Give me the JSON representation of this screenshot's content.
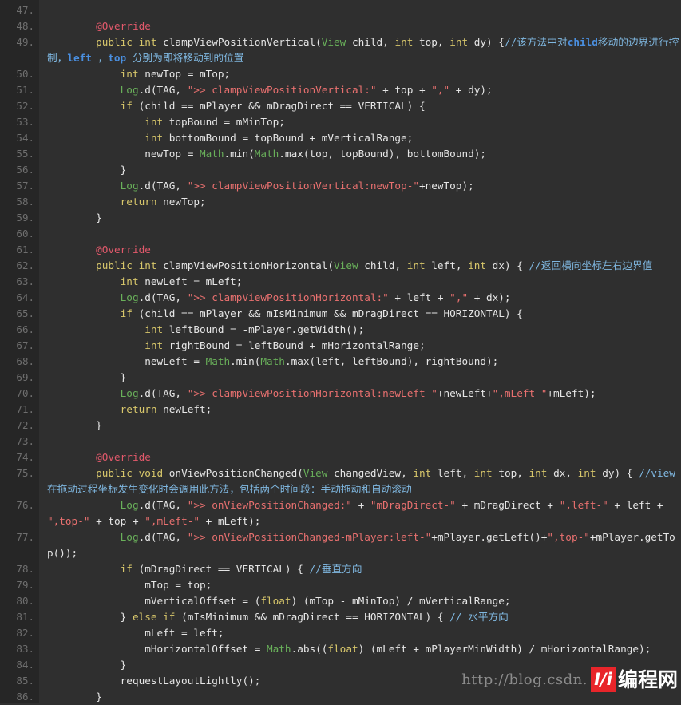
{
  "editor": {
    "language": "java",
    "theme": "dark",
    "background_color": "#2f2f2f",
    "gutter_color": "#262626",
    "first_line_number": 47,
    "last_line_number": 86
  },
  "colors": {
    "keyword": "#d8c76b",
    "annotation": "#e2596b",
    "string": "#e8706f",
    "class_name": "#69b05a",
    "comment": "#7fb7e0",
    "comment_bold": "#4a8fe0",
    "plain_text": "#e6e6e6",
    "line_number": "#6e6e6e",
    "watermark_red": "#e8252a"
  },
  "watermark": {
    "url": "http://blog.csdn.",
    "logo_mark": "I/i",
    "logo_text": "编程网"
  },
  "lines": [
    {
      "num": "47.",
      "wrapped": 0,
      "tokens": []
    },
    {
      "num": "48.",
      "wrapped": 0,
      "tokens": [
        {
          "c": "t-pl",
          "t": "        "
        },
        {
          "c": "t-ann",
          "t": "@Override"
        }
      ]
    },
    {
      "num": "49.",
      "wrapped": 1,
      "tokens": [
        {
          "c": "t-pl",
          "t": "        "
        },
        {
          "c": "t-kw",
          "t": "public"
        },
        {
          "c": "t-pl",
          "t": " "
        },
        {
          "c": "t-kw",
          "t": "int"
        },
        {
          "c": "t-pl",
          "t": " clampViewPositionVertical("
        },
        {
          "c": "t-cls",
          "t": "View"
        },
        {
          "c": "t-pl",
          "t": " child, "
        },
        {
          "c": "t-kw",
          "t": "int"
        },
        {
          "c": "t-pl",
          "t": " top, "
        },
        {
          "c": "t-kw",
          "t": "int"
        },
        {
          "c": "t-pl",
          "t": " dy) {"
        },
        {
          "c": "t-cmt",
          "t": "//该方法中对"
        },
        {
          "c": "t-cmt-b",
          "t": "child"
        },
        {
          "c": "t-cmt",
          "t": "移动的边界进行控制，"
        },
        {
          "c": "t-cmt-b",
          "t": "left"
        },
        {
          "c": "t-cmt",
          "t": " ，"
        },
        {
          "c": "t-cmt-b",
          "t": "top"
        },
        {
          "c": "t-cmt",
          "t": " 分别为即将移动到的位置"
        }
      ]
    },
    {
      "num": "50.",
      "wrapped": 0,
      "tokens": [
        {
          "c": "t-pl",
          "t": "            "
        },
        {
          "c": "t-kw",
          "t": "int"
        },
        {
          "c": "t-pl",
          "t": " newTop = mTop;"
        }
      ]
    },
    {
      "num": "51.",
      "wrapped": 0,
      "tokens": [
        {
          "c": "t-pl",
          "t": "            "
        },
        {
          "c": "t-cls",
          "t": "Log"
        },
        {
          "c": "t-pl",
          "t": ".d(TAG, "
        },
        {
          "c": "t-str",
          "t": "\">> clampViewPositionVertical:\""
        },
        {
          "c": "t-pl",
          "t": " + top + "
        },
        {
          "c": "t-str",
          "t": "\",\""
        },
        {
          "c": "t-pl",
          "t": " + dy);"
        }
      ]
    },
    {
      "num": "52.",
      "wrapped": 0,
      "tokens": [
        {
          "c": "t-pl",
          "t": "            "
        },
        {
          "c": "t-kw",
          "t": "if"
        },
        {
          "c": "t-pl",
          "t": " (child == mPlayer && mDragDirect == VERTICAL) {"
        }
      ]
    },
    {
      "num": "53.",
      "wrapped": 0,
      "tokens": [
        {
          "c": "t-pl",
          "t": "                "
        },
        {
          "c": "t-kw",
          "t": "int"
        },
        {
          "c": "t-pl",
          "t": " topBound = mMinTop;"
        }
      ]
    },
    {
      "num": "54.",
      "wrapped": 0,
      "tokens": [
        {
          "c": "t-pl",
          "t": "                "
        },
        {
          "c": "t-kw",
          "t": "int"
        },
        {
          "c": "t-pl",
          "t": " bottomBound = topBound + mVerticalRange;"
        }
      ]
    },
    {
      "num": "55.",
      "wrapped": 0,
      "tokens": [
        {
          "c": "t-pl",
          "t": "                newTop = "
        },
        {
          "c": "t-cls",
          "t": "Math"
        },
        {
          "c": "t-pl",
          "t": ".min("
        },
        {
          "c": "t-cls",
          "t": "Math"
        },
        {
          "c": "t-pl",
          "t": ".max(top, topBound), bottomBound);"
        }
      ]
    },
    {
      "num": "56.",
      "wrapped": 0,
      "tokens": [
        {
          "c": "t-pl",
          "t": "            }"
        }
      ]
    },
    {
      "num": "57.",
      "wrapped": 0,
      "tokens": [
        {
          "c": "t-pl",
          "t": "            "
        },
        {
          "c": "t-cls",
          "t": "Log"
        },
        {
          "c": "t-pl",
          "t": ".d(TAG, "
        },
        {
          "c": "t-str",
          "t": "\">> clampViewPositionVertical:newTop-\""
        },
        {
          "c": "t-pl",
          "t": "+newTop);"
        }
      ]
    },
    {
      "num": "58.",
      "wrapped": 0,
      "tokens": [
        {
          "c": "t-pl",
          "t": "            "
        },
        {
          "c": "t-kw",
          "t": "return"
        },
        {
          "c": "t-pl",
          "t": " newTop;"
        }
      ]
    },
    {
      "num": "59.",
      "wrapped": 0,
      "tokens": [
        {
          "c": "t-pl",
          "t": "        }"
        }
      ]
    },
    {
      "num": "60.",
      "wrapped": 0,
      "tokens": []
    },
    {
      "num": "61.",
      "wrapped": 0,
      "tokens": [
        {
          "c": "t-pl",
          "t": "        "
        },
        {
          "c": "t-ann",
          "t": "@Override"
        }
      ]
    },
    {
      "num": "62.",
      "wrapped": 0,
      "tokens": [
        {
          "c": "t-pl",
          "t": "        "
        },
        {
          "c": "t-kw",
          "t": "public"
        },
        {
          "c": "t-pl",
          "t": " "
        },
        {
          "c": "t-kw",
          "t": "int"
        },
        {
          "c": "t-pl",
          "t": " clampViewPositionHorizontal("
        },
        {
          "c": "t-cls",
          "t": "View"
        },
        {
          "c": "t-pl",
          "t": " child, "
        },
        {
          "c": "t-kw",
          "t": "int"
        },
        {
          "c": "t-pl",
          "t": " left, "
        },
        {
          "c": "t-kw",
          "t": "int"
        },
        {
          "c": "t-pl",
          "t": " dx) { "
        },
        {
          "c": "t-cmt",
          "t": "//返回横向坐标左右边界值"
        }
      ]
    },
    {
      "num": "63.",
      "wrapped": 0,
      "tokens": [
        {
          "c": "t-pl",
          "t": "            "
        },
        {
          "c": "t-kw",
          "t": "int"
        },
        {
          "c": "t-pl",
          "t": " newLeft = mLeft;"
        }
      ]
    },
    {
      "num": "64.",
      "wrapped": 0,
      "tokens": [
        {
          "c": "t-pl",
          "t": "            "
        },
        {
          "c": "t-cls",
          "t": "Log"
        },
        {
          "c": "t-pl",
          "t": ".d(TAG, "
        },
        {
          "c": "t-str",
          "t": "\">> clampViewPositionHorizontal:\""
        },
        {
          "c": "t-pl",
          "t": " + left + "
        },
        {
          "c": "t-str",
          "t": "\",\""
        },
        {
          "c": "t-pl",
          "t": " + dx);"
        }
      ]
    },
    {
      "num": "65.",
      "wrapped": 0,
      "tokens": [
        {
          "c": "t-pl",
          "t": "            "
        },
        {
          "c": "t-kw",
          "t": "if"
        },
        {
          "c": "t-pl",
          "t": " (child == mPlayer && mIsMinimum && mDragDirect == HORIZONTAL) {"
        }
      ]
    },
    {
      "num": "66.",
      "wrapped": 0,
      "tokens": [
        {
          "c": "t-pl",
          "t": "                "
        },
        {
          "c": "t-kw",
          "t": "int"
        },
        {
          "c": "t-pl",
          "t": " leftBound = -mPlayer.getWidth();"
        }
      ]
    },
    {
      "num": "67.",
      "wrapped": 0,
      "tokens": [
        {
          "c": "t-pl",
          "t": "                "
        },
        {
          "c": "t-kw",
          "t": "int"
        },
        {
          "c": "t-pl",
          "t": " rightBound = leftBound + mHorizontalRange;"
        }
      ]
    },
    {
      "num": "68.",
      "wrapped": 0,
      "tokens": [
        {
          "c": "t-pl",
          "t": "                newLeft = "
        },
        {
          "c": "t-cls",
          "t": "Math"
        },
        {
          "c": "t-pl",
          "t": ".min("
        },
        {
          "c": "t-cls",
          "t": "Math"
        },
        {
          "c": "t-pl",
          "t": ".max(left, leftBound), rightBound);"
        }
      ]
    },
    {
      "num": "69.",
      "wrapped": 0,
      "tokens": [
        {
          "c": "t-pl",
          "t": "            }"
        }
      ]
    },
    {
      "num": "70.",
      "wrapped": 0,
      "tokens": [
        {
          "c": "t-pl",
          "t": "            "
        },
        {
          "c": "t-cls",
          "t": "Log"
        },
        {
          "c": "t-pl",
          "t": ".d(TAG, "
        },
        {
          "c": "t-str",
          "t": "\">> clampViewPositionHorizontal:newLeft-\""
        },
        {
          "c": "t-pl",
          "t": "+newLeft+"
        },
        {
          "c": "t-str",
          "t": "\",mLeft-\""
        },
        {
          "c": "t-pl",
          "t": "+mLeft);"
        }
      ]
    },
    {
      "num": "71.",
      "wrapped": 0,
      "tokens": [
        {
          "c": "t-pl",
          "t": "            "
        },
        {
          "c": "t-kw",
          "t": "return"
        },
        {
          "c": "t-pl",
          "t": " newLeft;"
        }
      ]
    },
    {
      "num": "72.",
      "wrapped": 0,
      "tokens": [
        {
          "c": "t-pl",
          "t": "        }"
        }
      ]
    },
    {
      "num": "73.",
      "wrapped": 0,
      "tokens": []
    },
    {
      "num": "74.",
      "wrapped": 0,
      "tokens": [
        {
          "c": "t-pl",
          "t": "        "
        },
        {
          "c": "t-ann",
          "t": "@Override"
        }
      ]
    },
    {
      "num": "75.",
      "wrapped": 1,
      "tokens": [
        {
          "c": "t-pl",
          "t": "        "
        },
        {
          "c": "t-kw",
          "t": "public"
        },
        {
          "c": "t-pl",
          "t": " "
        },
        {
          "c": "t-kw",
          "t": "void"
        },
        {
          "c": "t-pl",
          "t": " onViewPositionChanged("
        },
        {
          "c": "t-cls",
          "t": "View"
        },
        {
          "c": "t-pl",
          "t": " changedView, "
        },
        {
          "c": "t-kw",
          "t": "int"
        },
        {
          "c": "t-pl",
          "t": " left, "
        },
        {
          "c": "t-kw",
          "t": "int"
        },
        {
          "c": "t-pl",
          "t": " top, "
        },
        {
          "c": "t-kw",
          "t": "int"
        },
        {
          "c": "t-pl",
          "t": " dx, "
        },
        {
          "c": "t-kw",
          "t": "int"
        },
        {
          "c": "t-pl",
          "t": " dy) { "
        },
        {
          "c": "t-cmt",
          "t": "//view在拖动过程坐标发生变化时会调用此方法，包括两个时间段：手动拖动和自动滚动"
        }
      ]
    },
    {
      "num": "76.",
      "wrapped": 1,
      "tokens": [
        {
          "c": "t-pl",
          "t": "            "
        },
        {
          "c": "t-cls",
          "t": "Log"
        },
        {
          "c": "t-pl",
          "t": ".d(TAG, "
        },
        {
          "c": "t-str",
          "t": "\">> onViewPositionChanged:\""
        },
        {
          "c": "t-pl",
          "t": " + "
        },
        {
          "c": "t-str",
          "t": "\"mDragDirect-\""
        },
        {
          "c": "t-pl",
          "t": " + mDragDirect + "
        },
        {
          "c": "t-str",
          "t": "\",left-\""
        },
        {
          "c": "t-pl",
          "t": " + left + "
        },
        {
          "c": "t-str",
          "t": "\",top-\""
        },
        {
          "c": "t-pl",
          "t": " + top + "
        },
        {
          "c": "t-str",
          "t": "\",mLeft-\""
        },
        {
          "c": "t-pl",
          "t": " + mLeft);"
        }
      ]
    },
    {
      "num": "77.",
      "wrapped": 1,
      "tokens": [
        {
          "c": "t-pl",
          "t": "            "
        },
        {
          "c": "t-cls",
          "t": "Log"
        },
        {
          "c": "t-pl",
          "t": ".d(TAG, "
        },
        {
          "c": "t-str",
          "t": "\">> onViewPositionChanged-mPlayer:left-\""
        },
        {
          "c": "t-pl",
          "t": "+mPlayer.getLeft()+"
        },
        {
          "c": "t-str",
          "t": "\",top-\""
        },
        {
          "c": "t-pl",
          "t": "+mPlayer.getTop());"
        }
      ]
    },
    {
      "num": "78.",
      "wrapped": 0,
      "tokens": [
        {
          "c": "t-pl",
          "t": "            "
        },
        {
          "c": "t-kw",
          "t": "if"
        },
        {
          "c": "t-pl",
          "t": " (mDragDirect == VERTICAL) { "
        },
        {
          "c": "t-cmt",
          "t": "//垂直方向"
        }
      ]
    },
    {
      "num": "79.",
      "wrapped": 0,
      "tokens": [
        {
          "c": "t-pl",
          "t": "                mTop = top;"
        }
      ]
    },
    {
      "num": "80.",
      "wrapped": 0,
      "tokens": [
        {
          "c": "t-pl",
          "t": "                mVerticalOffset = ("
        },
        {
          "c": "t-kw",
          "t": "float"
        },
        {
          "c": "t-pl",
          "t": ") (mTop - mMinTop) / mVerticalRange;"
        }
      ]
    },
    {
      "num": "81.",
      "wrapped": 0,
      "tokens": [
        {
          "c": "t-pl",
          "t": "            } "
        },
        {
          "c": "t-kw",
          "t": "else"
        },
        {
          "c": "t-pl",
          "t": " "
        },
        {
          "c": "t-kw",
          "t": "if"
        },
        {
          "c": "t-pl",
          "t": " (mIsMinimum && mDragDirect == HORIZONTAL) { "
        },
        {
          "c": "t-cmt",
          "t": "// 水平方向"
        }
      ]
    },
    {
      "num": "82.",
      "wrapped": 0,
      "tokens": [
        {
          "c": "t-pl",
          "t": "                mLeft = left;"
        }
      ]
    },
    {
      "num": "83.",
      "wrapped": 0,
      "tokens": [
        {
          "c": "t-pl",
          "t": "                mHorizontalOffset = "
        },
        {
          "c": "t-cls",
          "t": "Math"
        },
        {
          "c": "t-pl",
          "t": ".abs(("
        },
        {
          "c": "t-kw",
          "t": "float"
        },
        {
          "c": "t-pl",
          "t": ") (mLeft + mPlayerMinWidth) / mHorizontalRange);"
        }
      ]
    },
    {
      "num": "84.",
      "wrapped": 0,
      "tokens": [
        {
          "c": "t-pl",
          "t": "            }"
        }
      ]
    },
    {
      "num": "85.",
      "wrapped": 0,
      "tokens": [
        {
          "c": "t-pl",
          "t": "            requestLayoutLightly();"
        }
      ]
    },
    {
      "num": "86.",
      "wrapped": 0,
      "tokens": [
        {
          "c": "t-pl",
          "t": "        }"
        }
      ]
    }
  ]
}
